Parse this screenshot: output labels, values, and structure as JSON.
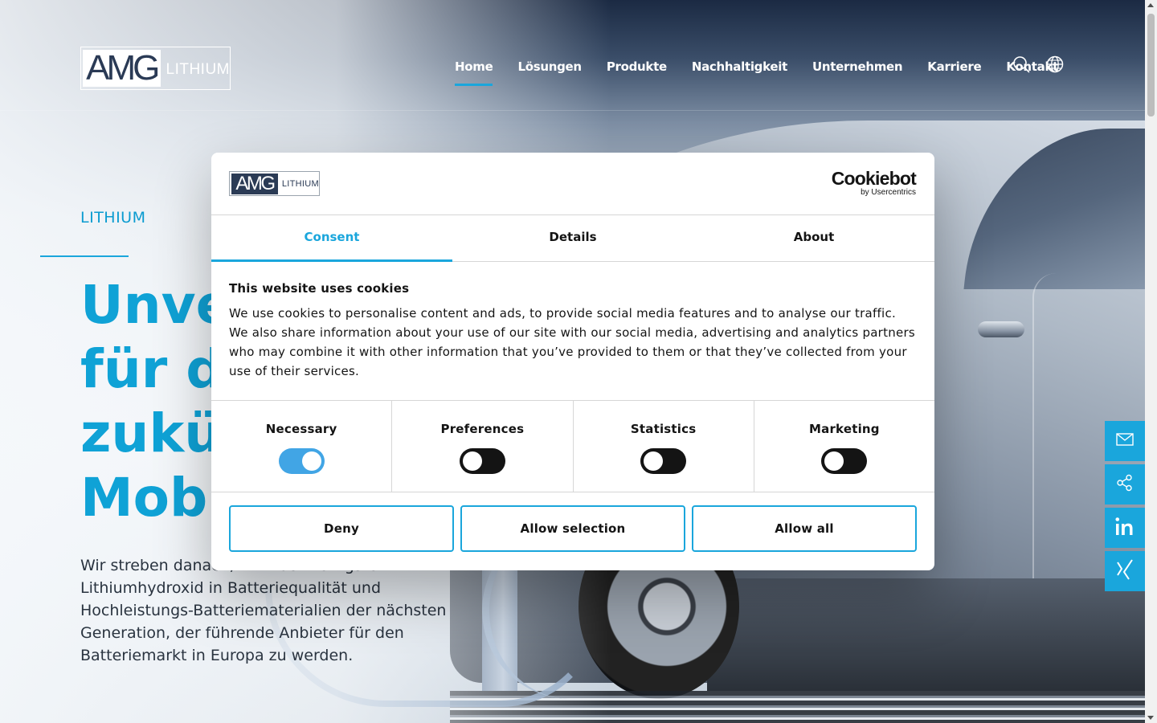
{
  "header": {
    "logo": {
      "mark": "AMG",
      "suffix": "LITHIUM"
    },
    "nav": [
      {
        "label": "Home",
        "active": true
      },
      {
        "label": "Lösungen",
        "active": false
      },
      {
        "label": "Produkte",
        "active": false
      },
      {
        "label": "Nachhaltigkeit",
        "active": false
      },
      {
        "label": "Unternehmen",
        "active": false
      },
      {
        "label": "Karriere",
        "active": false
      },
      {
        "label": "Kontakt",
        "active": false
      }
    ],
    "icons": [
      "search-icon",
      "globe-icon"
    ]
  },
  "hero": {
    "eyebrow": "LITHIUM",
    "headline_lines": [
      "Unve",
      "für di",
      "zukün",
      "Mobil"
    ],
    "body_lines": [
      "Wir streben danach, mit hochwertigstem",
      "Lithiumhydroxid in Batteriequalität und",
      "Hochleistungs-Batteriematerialien der nächsten",
      "Generation, der führende Anbieter für den",
      "Batteriemarkt in Europa zu werden."
    ]
  },
  "side_bar": [
    "mail-icon",
    "share-icon",
    "linkedin-icon",
    "xing-icon"
  ],
  "cookie_dialog": {
    "logo": {
      "mark": "AMG",
      "suffix": "LITHIUM"
    },
    "brand": {
      "name": "Cookiebot",
      "sub": "by Usercentrics"
    },
    "tabs": [
      {
        "label": "Consent",
        "active": true
      },
      {
        "label": "Details",
        "active": false
      },
      {
        "label": "About",
        "active": false
      }
    ],
    "title": "This website uses cookies",
    "text": "We use cookies to personalise content and ads, to provide social media features and to analyse our traffic. We also share information about your use of our site with our social media, advertising and analytics partners who may combine it with other information that you’ve provided to them or that they’ve collected from your use of their services.",
    "toggles": [
      {
        "label": "Necessary",
        "on": true
      },
      {
        "label": "Preferences",
        "on": false
      },
      {
        "label": "Statistics",
        "on": false
      },
      {
        "label": "Marketing",
        "on": false
      }
    ],
    "buttons": {
      "deny": "Deny",
      "allow_selection": "Allow selection",
      "allow_all": "Allow all"
    }
  },
  "colors": {
    "accent": "#1aa6dc",
    "toggle_on": "#41a5e5",
    "toggle_off": "#141414",
    "text": "#141414"
  }
}
